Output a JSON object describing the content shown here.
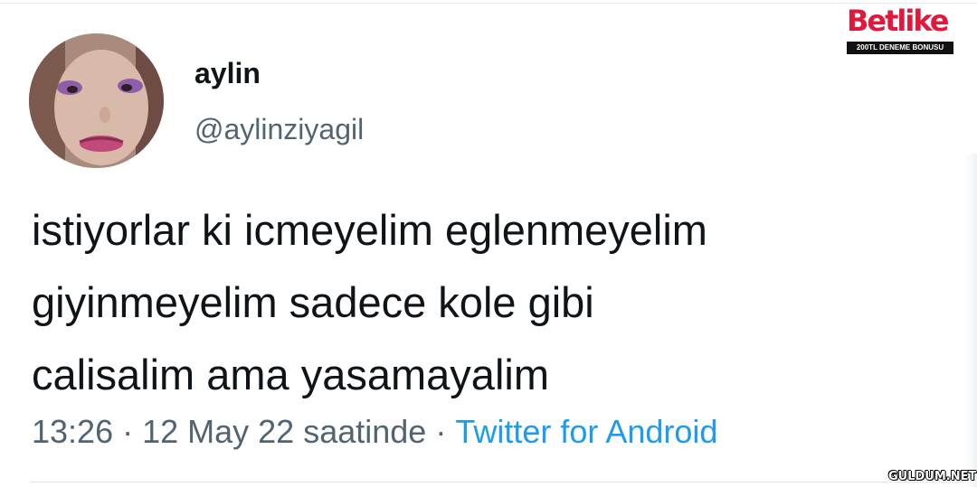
{
  "brand": {
    "logo_text": "Betlike",
    "tagline": "200TL DENEME BONUSU",
    "color": "#e0183c"
  },
  "tweet": {
    "author": {
      "display_name": "aylin",
      "username": "@aylinziyagil",
      "avatar_icon": "profile-photo"
    },
    "text_lines": [
      "istiyorlar ki icmeyelim eglenmeyelim",
      "giyinmeyelim sadece kole gibi",
      "calisalim ama yasamayalim"
    ],
    "meta": {
      "time": "13:26",
      "separator": "·",
      "date": "12 May 22 saatinde",
      "source": "Twitter for Android"
    }
  },
  "watermark": {
    "text": "GULDUM.NET"
  },
  "colors": {
    "text_primary": "#0f1419",
    "text_secondary": "#536471",
    "link": "#1d9bf0"
  }
}
